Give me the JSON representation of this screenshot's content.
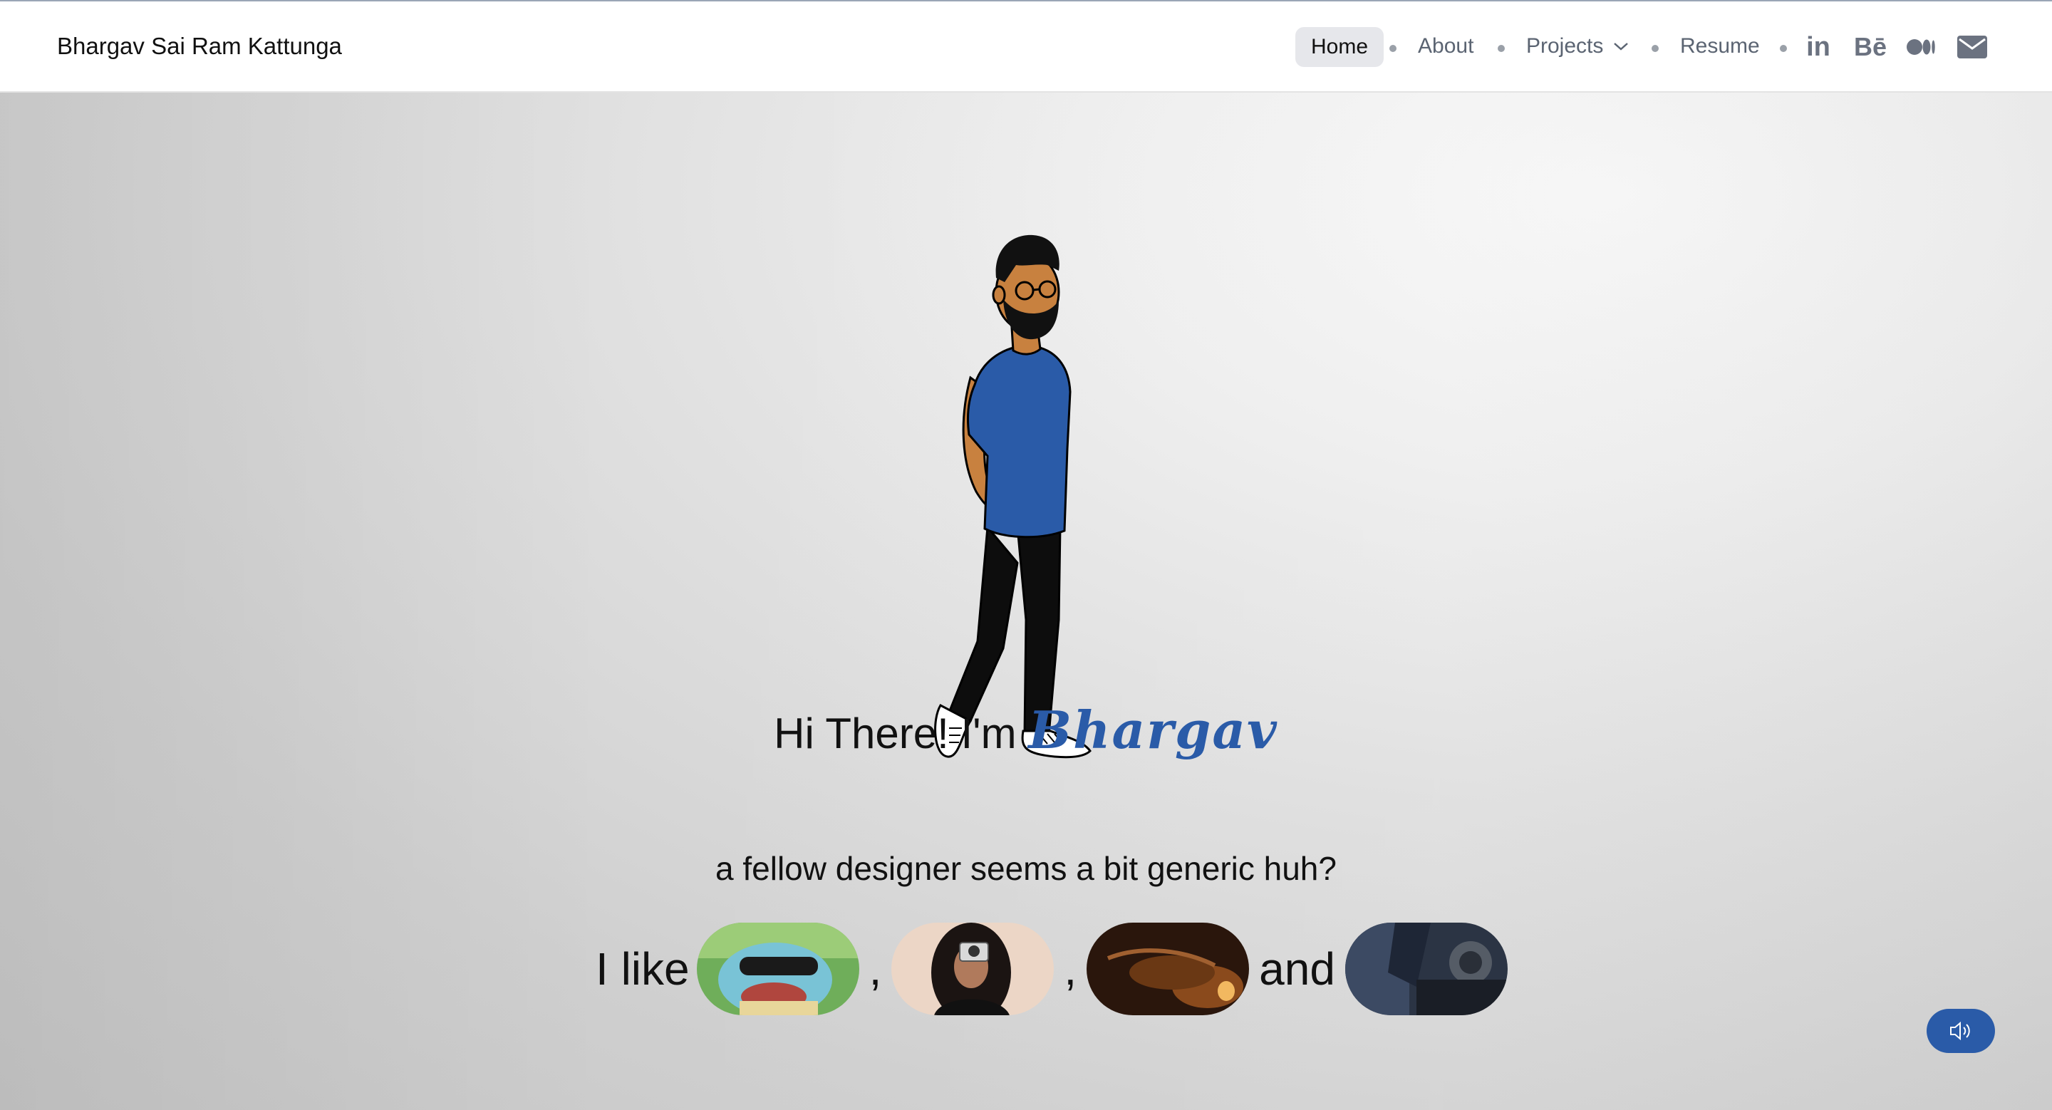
{
  "brand": {
    "name": "Bhargav Sai Ram Kattunga"
  },
  "nav": {
    "home": "Home",
    "about": "About",
    "projects": "Projects",
    "resume": "Resume",
    "social": {
      "linkedin": "in",
      "behance": "Bē",
      "medium_icon": "medium-icon",
      "mail_icon": "mail-icon"
    }
  },
  "hero": {
    "greeting_prefix": "Hi There! I'm",
    "greeting_name": "Bhargav",
    "subtitle": "a fellow designer seems a bit generic huh?",
    "likes_prefix": "I like",
    "separator_1": ",",
    "separator_2": ",",
    "likes_and": "and"
  },
  "sound_button": {
    "icon": "speaker-icon"
  },
  "colors": {
    "accent": "#2a5ba8",
    "nav_active_bg": "#e6e7eb",
    "nav_text": "#5b6472"
  }
}
